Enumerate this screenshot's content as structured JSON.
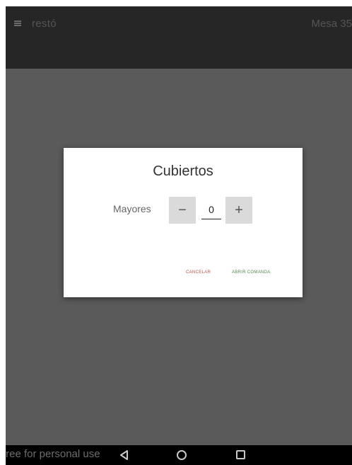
{
  "appbar": {
    "title": "restó",
    "table_label": "Mesa 35"
  },
  "dialog": {
    "title": "Cubiertos",
    "adults_label": "Mayores",
    "decrement_symbol": "−",
    "increment_symbol": "+",
    "adults_count": "0",
    "cancel_label": "CANCELAR",
    "open_label": "ABRIR COMANDA"
  },
  "navbar": {
    "watermark": "free for personal use"
  },
  "colors": {
    "appbar_bg": "#262626",
    "overlay_bg": "#5a5a5a",
    "cancel_text": "#c0534d",
    "open_text": "#4f8a4f"
  },
  "icons": [
    "menu-icon",
    "back-icon",
    "home-icon",
    "recents-icon"
  ]
}
